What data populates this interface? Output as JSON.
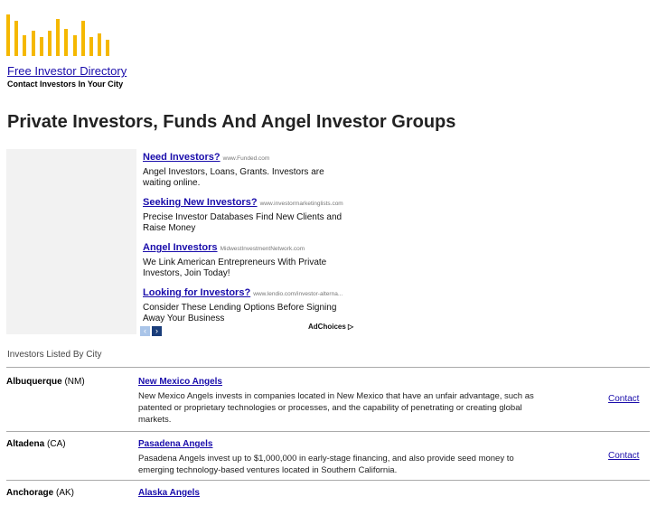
{
  "brand": {
    "logo_color": "#f5b800",
    "logo_bars": [
      1.0,
      0.85,
      0.5,
      0.6,
      0.45,
      0.6,
      0.9,
      0.65,
      0.5,
      0.85,
      0.45,
      0.55,
      0.4
    ],
    "title": "Free Investor Directory",
    "subtitle": "Contact Investors In Your City"
  },
  "page_title": "Private Investors, Funds And Angel Investor Groups",
  "ads": [
    {
      "title": "Need Investors?",
      "url": "www.Funded.com",
      "desc": "Angel Investors, Loans, Grants. Investors are waiting online."
    },
    {
      "title": "Seeking New Investors?",
      "url": "www.investormarketinglists.com",
      "desc": "Precise Investor Databases Find New Clients and Raise Money"
    },
    {
      "title": "Angel Investors",
      "url": "MidwestInvestmentNetwork.com",
      "desc": "We Link American Entrepreneurs With Private Investors, Join Today!"
    },
    {
      "title": "Looking for Investors?",
      "url": "www.lendio.com/investor-alterna...",
      "desc": "Consider These Lending Options Before Signing Away Your Business"
    }
  ],
  "ad_nav": {
    "prev": "‹",
    "next": "›",
    "adchoices": "AdChoices ▷"
  },
  "section_label": "Investors Listed By City",
  "listings": [
    {
      "city": "Albuquerque",
      "state": "(NM)",
      "name": "New Mexico Angels",
      "desc": "New Mexico Angels invests in companies located in New Mexico that have an unfair advantage, such as patented or proprietary technologies or processes, and the capability of penetrating or creating global markets.",
      "contact": "Contact"
    },
    {
      "city": "Altadena",
      "state": "(CA)",
      "name": "Pasadena Angels",
      "desc": "Pasadena Angels invest up to $1,000,000 in early-stage financing, and also provide seed money to emerging technology-based ventures located in Southern California.",
      "contact": "Contact"
    },
    {
      "city": "Anchorage",
      "state": "(AK)",
      "name": "Alaska Angels",
      "desc": "",
      "contact": ""
    }
  ]
}
